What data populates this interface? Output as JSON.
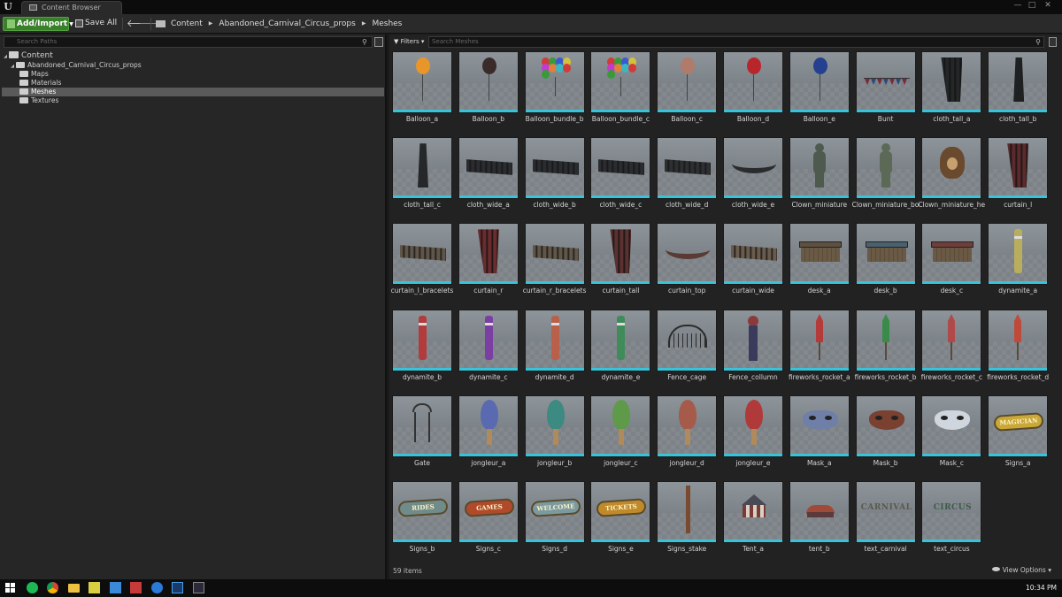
{
  "window": {
    "tab_title": "Content Browser",
    "logo": "U",
    "minimize": "—",
    "maximize": "□",
    "close": "✕"
  },
  "toolbar": {
    "add_import_label": "Add/Import",
    "save_all_label": "Save All",
    "back_icon": "arrow-left-icon",
    "forward_icon": "arrow-right-icon"
  },
  "breadcrumb": [
    "Content",
    "Abandoned_Carnival_Circus_props",
    "Meshes"
  ],
  "sources": {
    "search_placeholder": "Search Paths",
    "tree": {
      "root": "Content",
      "project": "Abandoned_Carnival_Circus_props",
      "folders": [
        {
          "label": "Maps",
          "selected": false
        },
        {
          "label": "Materials",
          "selected": false
        },
        {
          "label": "Meshes",
          "selected": true
        },
        {
          "label": "Textures",
          "selected": false
        }
      ]
    }
  },
  "assets": {
    "filters_label": "Filters",
    "search_placeholder": "Search Meshes",
    "items_count": "59 items",
    "view_options_label": "View Options",
    "accent_color": "#39c3d8",
    "items": [
      {
        "name": "Balloon_a",
        "kind": "balloon",
        "color": "#e8962a"
      },
      {
        "name": "Balloon_b",
        "kind": "balloon",
        "color": "#3b2a2a"
      },
      {
        "name": "Balloon_bundle_b",
        "kind": "bundle",
        "color": "#cc3a3a"
      },
      {
        "name": "Balloon_bundle_c",
        "kind": "bundle",
        "color": "#c93aa0"
      },
      {
        "name": "Balloon_c",
        "kind": "balloon",
        "color": "#b07b6a"
      },
      {
        "name": "Balloon_d",
        "kind": "balloon",
        "color": "#b8262b"
      },
      {
        "name": "Balloon_e",
        "kind": "balloon",
        "color": "#24408f"
      },
      {
        "name": "Bunt",
        "kind": "bunt",
        "color": "#7b2a3a"
      },
      {
        "name": "cloth_tall_a",
        "kind": "curtain",
        "color": "#242628"
      },
      {
        "name": "cloth_tall_b",
        "kind": "drape",
        "color": "#1f2022"
      },
      {
        "name": "cloth_tall_c",
        "kind": "drape",
        "color": "#262729"
      },
      {
        "name": "cloth_wide_a",
        "kind": "cloth",
        "color": "#2a2c2f"
      },
      {
        "name": "cloth_wide_b",
        "kind": "cloth",
        "color": "#2a2c2f"
      },
      {
        "name": "cloth_wide_c",
        "kind": "cloth",
        "color": "#2a2c2f"
      },
      {
        "name": "cloth_wide_d",
        "kind": "cloth",
        "color": "#2d2f31"
      },
      {
        "name": "cloth_wide_e",
        "kind": "arc",
        "color": "#2a2b2d"
      },
      {
        "name": "Clown_miniature",
        "kind": "clown",
        "color": "#4f5a4f"
      },
      {
        "name": "Clown_miniature_body",
        "kind": "clown",
        "color": "#5c6957"
      },
      {
        "name": "Clown_miniature_head",
        "kind": "head",
        "color": "#6a4a2e"
      },
      {
        "name": "curtain_l",
        "kind": "curtain",
        "color": "#5a2a2c"
      },
      {
        "name": "curtain_l_bracelets",
        "kind": "cloth",
        "color": "#5f5548"
      },
      {
        "name": "curtain_r",
        "kind": "curtain",
        "color": "#6a2c2e"
      },
      {
        "name": "curtain_r_bracelets",
        "kind": "cloth",
        "color": "#615648"
      },
      {
        "name": "curtain_tall",
        "kind": "curtain",
        "color": "#5b3030"
      },
      {
        "name": "curtain_top",
        "kind": "arc",
        "color": "#5a3a34"
      },
      {
        "name": "curtain_wide",
        "kind": "cloth",
        "color": "#6a5c4c"
      },
      {
        "name": "desk_a",
        "kind": "desk",
        "color": "#5d5040"
      },
      {
        "name": "desk_b",
        "kind": "desk",
        "color": "#4a6270"
      },
      {
        "name": "desk_c",
        "kind": "desk",
        "color": "#6e3e3a"
      },
      {
        "name": "dynamite_a",
        "kind": "stick",
        "color": "#b9ae5e"
      },
      {
        "name": "dynamite_b",
        "kind": "stick",
        "color": "#b33b3b"
      },
      {
        "name": "dynamite_c",
        "kind": "stick",
        "color": "#7b3fa3"
      },
      {
        "name": "dynamite_d",
        "kind": "stick",
        "color": "#b8604a"
      },
      {
        "name": "dynamite_e",
        "kind": "stick",
        "color": "#3f8c5a"
      },
      {
        "name": "Fence_cage",
        "kind": "fence",
        "color": "#2c2c2c"
      },
      {
        "name": "Fence_collumn",
        "kind": "column",
        "color": "#3a3a5c"
      },
      {
        "name": "fireworks_rocket_a",
        "kind": "rocket",
        "color": "#b53b3b"
      },
      {
        "name": "fireworks_rocket_b",
        "kind": "rocket",
        "color": "#3a8a4a"
      },
      {
        "name": "fireworks_rocket_c",
        "kind": "rocket",
        "color": "#b04a4a"
      },
      {
        "name": "fireworks_rocket_d",
        "kind": "rocket",
        "color": "#c04a3a"
      },
      {
        "name": "Gate",
        "kind": "gate",
        "color": "#333333"
      },
      {
        "name": "jongleur_a",
        "kind": "club",
        "color": "#5a6ab0"
      },
      {
        "name": "jongleur_b",
        "kind": "club",
        "color": "#3d8a82"
      },
      {
        "name": "jongleur_c",
        "kind": "club",
        "color": "#5e9a4a"
      },
      {
        "name": "jongleur_d",
        "kind": "club",
        "color": "#a65a4a"
      },
      {
        "name": "jongleur_e",
        "kind": "club",
        "color": "#b03a3a"
      },
      {
        "name": "Mask_a",
        "kind": "mask",
        "color": "#6f7fa8"
      },
      {
        "name": "Mask_b",
        "kind": "mask",
        "color": "#7a4030"
      },
      {
        "name": "Mask_c",
        "kind": "mask",
        "color": "#cfd6de"
      },
      {
        "name": "Signs_a",
        "kind": "sign",
        "color": "#c9a838",
        "sign_text": "MAGICIAN"
      },
      {
        "name": "Signs_b",
        "kind": "sign",
        "color": "#6f8c8a",
        "sign_text": "RIDES"
      },
      {
        "name": "Signs_c",
        "kind": "sign",
        "color": "#b04a2a",
        "sign_text": "GAMES"
      },
      {
        "name": "Signs_d",
        "kind": "sign",
        "color": "#7a9aa0",
        "sign_text": "WELCOME"
      },
      {
        "name": "Signs_e",
        "kind": "sign",
        "color": "#c08a2a",
        "sign_text": "TICKETS"
      },
      {
        "name": "Signs_stake",
        "kind": "stake",
        "color": "#7a4a30"
      },
      {
        "name": "Tent_a",
        "kind": "tent",
        "color": "#4a4a55"
      },
      {
        "name": "tent_b",
        "kind": "tentb",
        "color": "#a04a3a"
      },
      {
        "name": "text_carnival",
        "kind": "text",
        "color": "#5a5a4a",
        "sign_text": "CARNIVAL"
      },
      {
        "name": "text_circus",
        "kind": "text",
        "color": "#3f5a4a",
        "sign_text": "CIRCUS"
      }
    ]
  },
  "taskbar": {
    "icons": [
      "windows-logo-icon",
      "spotify-icon",
      "chrome-icon",
      "file-explorer-icon",
      "sticky-notes-icon",
      "mail-icon",
      "calculator-icon",
      "edge-icon",
      "photoshop-icon",
      "unreal-engine-icon"
    ],
    "clock": "10:34 PM"
  }
}
